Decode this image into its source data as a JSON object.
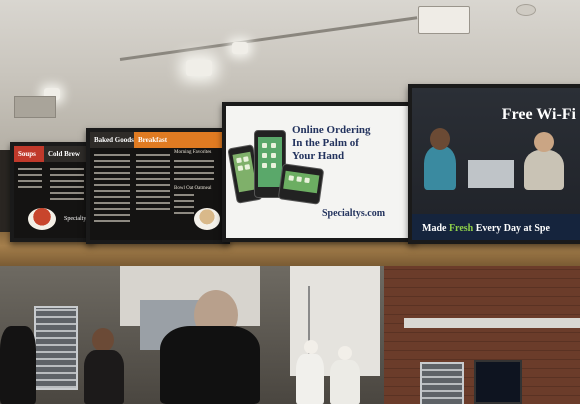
{
  "scene": {
    "description_free": true
  },
  "menu_board_1": {
    "headers": [
      "Soups",
      "Cold Brew"
    ],
    "brand": "Specialtys"
  },
  "menu_board_2": {
    "headers": [
      "Baked Goods",
      "Breakfast",
      "Morning Favorites"
    ],
    "sub_header": "Bowl Oat Oatmeal"
  },
  "ad_screen": {
    "headline_line1": "Online Ordering",
    "headline_line2": "In the Palm of",
    "headline_line3": "Your Hand",
    "domain": "Specialtys.com"
  },
  "wifi_screen": {
    "title": "Free Wi-Fi",
    "tagline_pre": "Made ",
    "tagline_fresh": "Fresh",
    "tagline_post": " Every Day at Spe"
  },
  "colors": {
    "menu_red": "#c0392b",
    "menu_orange": "#e07b22",
    "ad_navy": "#23335e",
    "fresh_green": "#8fcf4a",
    "wifi_bar": "#15243d"
  }
}
